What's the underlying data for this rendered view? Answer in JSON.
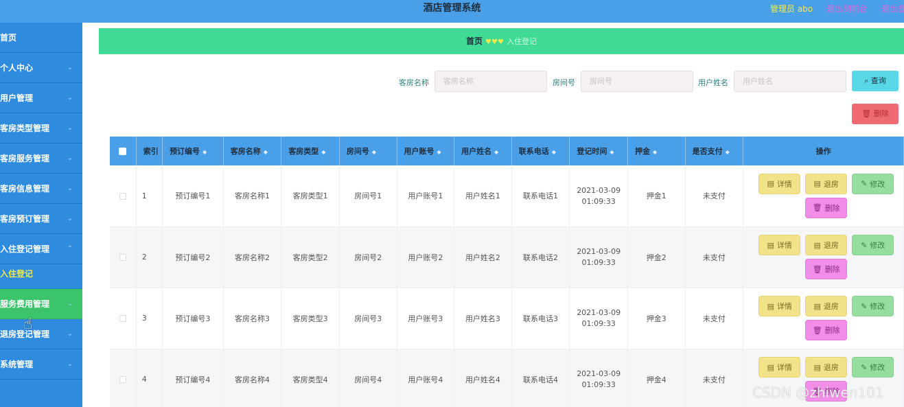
{
  "header": {
    "title": "酒店管理系统",
    "admin": "管理员 abo",
    "exit_front": "退出到前台",
    "exit_login": "退出登"
  },
  "sidebar": {
    "items": [
      {
        "label": "首页",
        "chevron": false
      },
      {
        "label": "个人中心",
        "chevron": true
      },
      {
        "label": "用户管理",
        "chevron": true
      },
      {
        "label": "客房类型管理",
        "chevron": true
      },
      {
        "label": "客房服务管理",
        "chevron": true
      },
      {
        "label": "客房信息管理",
        "chevron": true
      },
      {
        "label": "客房预订管理",
        "chevron": true
      },
      {
        "label": "入住登记管理",
        "chevron": true
      }
    ],
    "sub_item": "入住登记",
    "active_item": "服务费用管理",
    "after_items": [
      {
        "label": "退房登记管理"
      },
      {
        "label": "系统管理"
      }
    ]
  },
  "breadcrumb": {
    "home": "首页",
    "current": "入住登记"
  },
  "search": {
    "room_name_label": "客房名称",
    "room_name_placeholder": "客房名称",
    "room_no_label": "房间号",
    "room_no_placeholder": "房间号",
    "user_name_label": "用户姓名",
    "user_name_placeholder": "用户姓名",
    "query_label": "查询",
    "delete_label": "删除"
  },
  "table": {
    "headers": [
      "索引",
      "预订编号",
      "客房名称",
      "客房类型",
      "房间号",
      "用户账号",
      "用户姓名",
      "联系电话",
      "登记时间",
      "押金",
      "是否支付",
      "操作"
    ],
    "rows": [
      {
        "index": "1",
        "booking": "预订编号1",
        "room_name": "客房名称1",
        "room_type": "客房类型1",
        "room_no": "房间号1",
        "account": "用户账号1",
        "user_name": "用户姓名1",
        "phone": "联系电话1",
        "date": "2021-03-09",
        "time": "01:09:33",
        "deposit": "押金1",
        "paid": "未支付"
      },
      {
        "index": "2",
        "booking": "预订编号2",
        "room_name": "客房名称2",
        "room_type": "客房类型2",
        "room_no": "房间号2",
        "account": "用户账号2",
        "user_name": "用户姓名2",
        "phone": "联系电话2",
        "date": "2021-03-09",
        "time": "01:09:33",
        "deposit": "押金2",
        "paid": "未支付"
      },
      {
        "index": "3",
        "booking": "预订编号3",
        "room_name": "客房名称3",
        "room_type": "客房类型3",
        "room_no": "房间号3",
        "account": "用户账号3",
        "user_name": "用户姓名3",
        "phone": "联系电话3",
        "date": "2021-03-09",
        "time": "01:09:33",
        "deposit": "押金3",
        "paid": "未支付"
      },
      {
        "index": "4",
        "booking": "预订编号4",
        "room_name": "客房名称4",
        "room_type": "客房类型4",
        "room_no": "房间号4",
        "account": "用户账号4",
        "user_name": "用户姓名4",
        "phone": "联系电话4",
        "date": "2021-03-09",
        "time": "01:09:33",
        "deposit": "押金4",
        "paid": "未支付"
      }
    ],
    "actions": {
      "detail": "详情",
      "checkout": "退房",
      "edit": "修改",
      "delete": "删除"
    }
  },
  "watermark": "CSDN @zhiwen101"
}
